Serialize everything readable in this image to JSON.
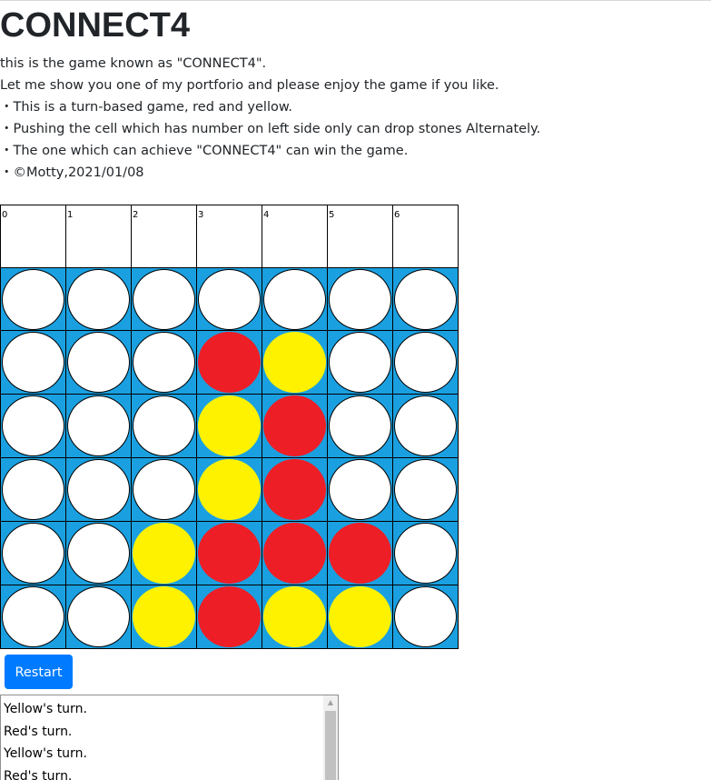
{
  "page": {
    "title": "CONNECT4",
    "description": [
      "this is the game known as \"CONNECT4\".",
      "Let me show you one of my portforio and please enjoy the game if you like.",
      "・This is a turn-based game, red and yellow.",
      "・Pushing the cell which has number on left side only can drop stones Alternately.",
      "・The one which can achieve \"CONNECT4\" can win the game.",
      "・©Motty,2021/01/08"
    ]
  },
  "board": {
    "columns": [
      "0",
      "1",
      "2",
      "3",
      "4",
      "5",
      "6"
    ],
    "rows": [
      [
        "empty",
        "empty",
        "empty",
        "empty",
        "empty",
        "empty",
        "empty"
      ],
      [
        "empty",
        "empty",
        "empty",
        "red",
        "yellow",
        "empty",
        "empty"
      ],
      [
        "empty",
        "empty",
        "empty",
        "yellow",
        "red",
        "empty",
        "empty"
      ],
      [
        "empty",
        "empty",
        "empty",
        "yellow",
        "red",
        "empty",
        "empty"
      ],
      [
        "empty",
        "empty",
        "yellow",
        "red",
        "red",
        "red",
        "empty"
      ],
      [
        "empty",
        "empty",
        "yellow",
        "red",
        "yellow",
        "yellow",
        "empty"
      ]
    ],
    "colors": {
      "board": "#1aa0e0",
      "red": "#ee1e26",
      "yellow": "#fff200",
      "empty": "#ffffff"
    }
  },
  "controls": {
    "restart_label": "Restart",
    "restart_color": "#007bff"
  },
  "log": {
    "lines": [
      "Yellow's turn.",
      "Red's turn.",
      "Yellow's turn.",
      "Red's turn."
    ],
    "scroll_up_icon": "triangle-up-icon"
  }
}
